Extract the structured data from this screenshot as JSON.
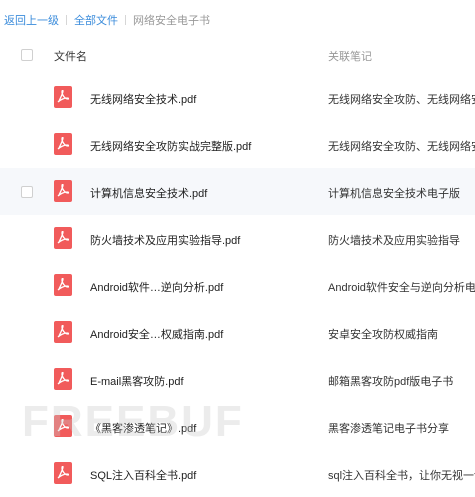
{
  "breadcrumb": {
    "back": "返回上一级",
    "all_files": "全部文件",
    "current": "网络安全电子书"
  },
  "header": {
    "name": "文件名",
    "notes": "关联笔记"
  },
  "icons": {
    "file": "pdf-icon",
    "color": "#f15b5b"
  },
  "files": [
    {
      "name": "无线网络安全技术.pdf",
      "note": "无线网络安全攻防、无线网络安全技术"
    },
    {
      "name": "无线网络安全攻防实战完整版.pdf",
      "note": "无线网络安全攻防、无线网络安全技术"
    },
    {
      "name": "计算机信息安全技术.pdf",
      "note": "计算机信息安全技术电子版"
    },
    {
      "name": "防火墙技术及应用实验指导.pdf",
      "note": "防火墙技术及应用实验指导"
    },
    {
      "name": "Android软件…逆向分析.pdf",
      "note": "Android软件安全与逆向分析电子书"
    },
    {
      "name": "Android安全…权威指南.pdf",
      "note": "安卓安全攻防权威指南"
    },
    {
      "name": "E-mail黑客攻防.pdf",
      "note": "邮箱黑客攻防pdf版电子书"
    },
    {
      "name": "《黑客渗透笔记》.pdf",
      "note": "黑客渗透笔记电子书分享"
    },
    {
      "name": "SQL注入百科全书.pdf",
      "note": "sql注入百科全书，让你无视一切防御"
    }
  ],
  "watermark": "FREEBUF"
}
